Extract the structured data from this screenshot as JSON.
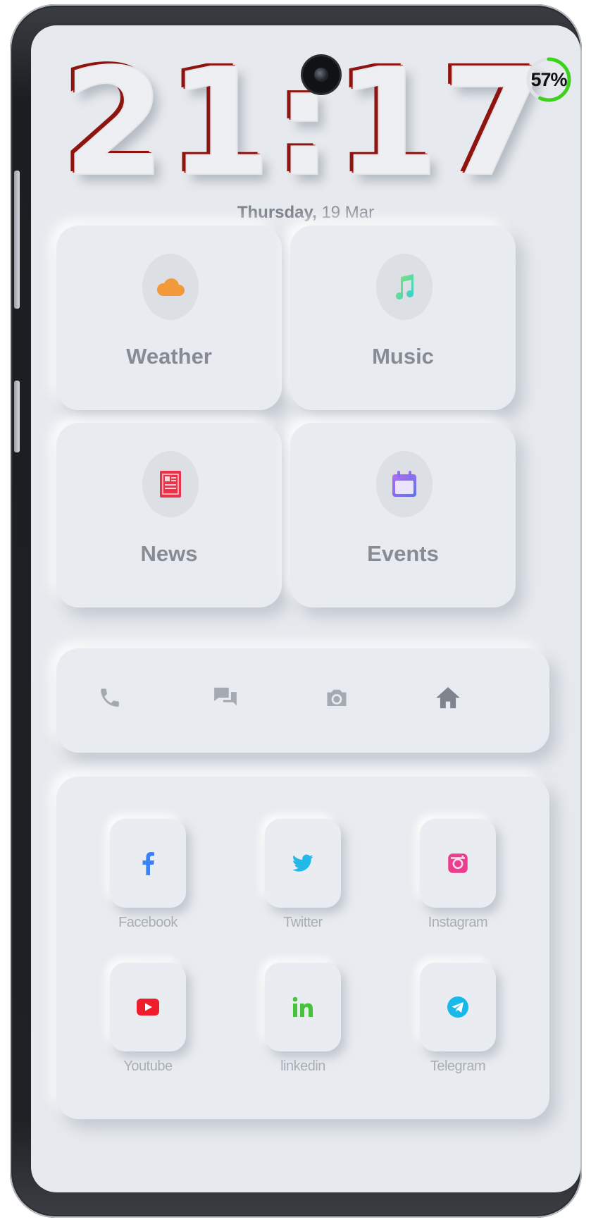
{
  "status": {
    "clock": "21:17",
    "battery_percent": 57,
    "battery_label": "57%",
    "battery_color": "#3bd21a"
  },
  "date": {
    "weekday": "Thursday,",
    "day_month": "19 Mar"
  },
  "tiles": [
    {
      "label": "Weather",
      "icon": "cloud-icon",
      "color": "#f29a3a"
    },
    {
      "label": "Music",
      "icon": "music-note-icon",
      "color": "#48d7c2"
    },
    {
      "label": "News",
      "icon": "newspaper-icon",
      "color": "#e8334a"
    },
    {
      "label": "Events",
      "icon": "calendar-icon",
      "color": "#7b6cf0"
    }
  ],
  "dock": [
    {
      "icon": "phone-icon"
    },
    {
      "icon": "chat-icon"
    },
    {
      "icon": "camera-icon"
    },
    {
      "icon": "home-icon"
    }
  ],
  "social": [
    {
      "label": "Facebook",
      "icon": "facebook-icon",
      "color": "#3b82f6"
    },
    {
      "label": "Twitter",
      "icon": "twitter-icon",
      "color": "#22b8e8"
    },
    {
      "label": "Instagram",
      "icon": "instagram-icon",
      "color": "#ec3d8e"
    },
    {
      "label": "Youtube",
      "icon": "youtube-icon",
      "color": "#ef1d2b"
    },
    {
      "label": "linkedin",
      "icon": "linkedin-icon",
      "color": "#46c33b"
    },
    {
      "label": "Telegram",
      "icon": "telegram-icon",
      "color": "#19b8ea"
    }
  ]
}
